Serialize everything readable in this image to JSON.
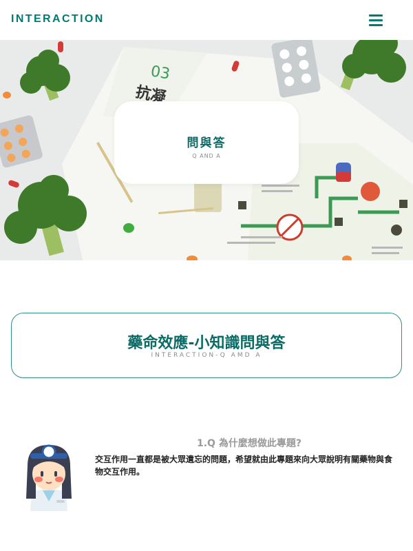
{
  "header": {
    "logo": "INTERACTION",
    "menu_icon": "hamburger-menu-icon"
  },
  "hero": {
    "title": "問與答",
    "subtitle": "Q AND A",
    "brochure_number": "03",
    "brochure_heading": "抗凝"
  },
  "section": {
    "title": "藥命效應-小知識問與答",
    "subtitle": "INTERACTION-Q AMD A"
  },
  "qa": [
    {
      "question": "1.Q 為什麼想做此專題?",
      "answer": "交互作用一直都是被大眾遺忘的問題，希望就由此專題來向大眾說明有關藥物與食物交互作用。",
      "avatar_icon": "doctor-avatar-icon"
    }
  ],
  "colors": {
    "brand": "#007a72",
    "title": "#0a6b66",
    "border": "#2a8f88"
  }
}
